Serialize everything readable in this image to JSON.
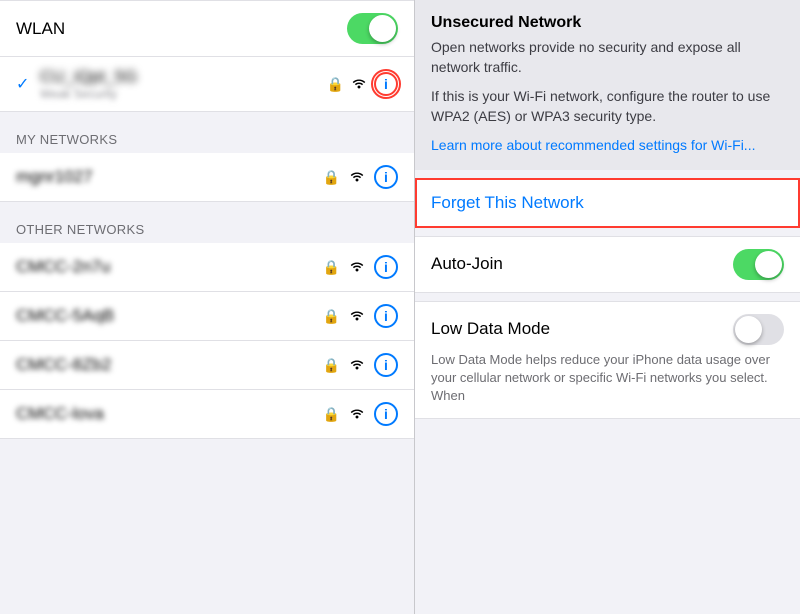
{
  "left": {
    "wlan_label": "WLAN",
    "wlan_on": true,
    "connected_network": {
      "name": "CU_iQpt_5G",
      "sub": "Weak Security"
    },
    "my_networks_header": "MY NETWORKS",
    "my_networks": [
      {
        "name": "mgnr1027"
      }
    ],
    "other_networks_header": "OTHER NETWORKS",
    "other_networks": [
      {
        "name": "CMCC-2n7u"
      },
      {
        "name": "CMCC-5AqB"
      },
      {
        "name": "CMCC-8Zb2"
      },
      {
        "name": "CMCC-lova"
      }
    ]
  },
  "right": {
    "unsecured_title": "Unsecured Network",
    "unsecured_text1": "Open networks provide no security and expose all network traffic.",
    "unsecured_text2": "If this is your Wi-Fi network, configure the router to use WPA2 (AES) or WPA3 security type.",
    "learn_more_link": "Learn more about recommended settings for Wi-Fi...",
    "forget_label": "Forget This Network",
    "auto_join_label": "Auto-Join",
    "low_data_label": "Low Data Mode",
    "low_data_desc": "Low Data Mode helps reduce your iPhone data usage over your cellular network or specific Wi-Fi networks you select. When"
  },
  "icons": {
    "info": "ℹ",
    "lock": "🔒",
    "wifi": "📶",
    "check": "✓"
  }
}
